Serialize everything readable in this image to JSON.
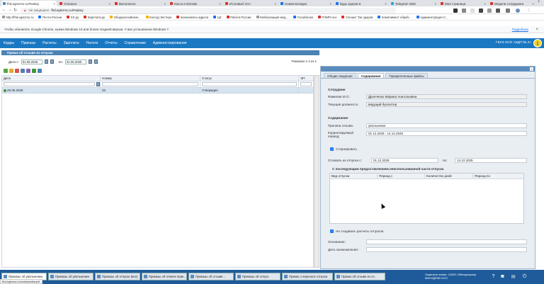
{
  "browser": {
    "tabs": [
      {
        "label": "fhd.egiszrso.ru/#salary",
        "color": "#4a83b4",
        "active": true
      },
      {
        "label": "Успешно",
        "color": "#d93025"
      },
      {
        "label": "Выполнено",
        "color": "#d93025"
      },
      {
        "label": "Касса в Москве",
        "color": "#d93025"
      },
      {
        "label": "Итоговый тест",
        "color": "#d93025"
      },
      {
        "label": "Новая вкладка",
        "color": "#1a73e8"
      },
      {
        "label": "Будь здоров в",
        "color": "#1a73e8"
      },
      {
        "label": "Telegram Web",
        "color": "#2aa3e0"
      },
      {
        "label": "Моя страница",
        "color": "#d93025"
      },
      {
        "label": "Модели сотрудника",
        "color": "#d93025"
      }
    ],
    "insecure_label": "Не защищено",
    "url": "fhd.egiszrso.ru/#salary",
    "bookmarks": [
      {
        "label": "http://fhd.egiszrso.ru",
        "color": "#999999"
      },
      {
        "label": "Почта России",
        "color": "#1a73e8"
      },
      {
        "label": "XX.ру",
        "color": "#d93025"
      },
      {
        "label": "Зарплата.ру",
        "color": "#d93025"
      },
      {
        "label": "Общероссийские...",
        "color": "#f4b400"
      },
      {
        "label": "Контур.Экстерн",
        "color": "#f4b400"
      },
      {
        "label": "военкоматы адреса",
        "color": "#d93025"
      },
      {
        "label": "ЦЗ",
        "color": "#1a73e8"
      },
      {
        "label": "Работа России",
        "color": "#d93025"
      },
      {
        "label": "Мобилизация мед...",
        "color": "#999999"
      },
      {
        "label": "Госзаблоки",
        "color": "#1a73e8"
      },
      {
        "label": "РЭМП-нсо",
        "color": "#d93025"
      },
      {
        "label": "Спешит Так здоров",
        "color": "#d93025"
      },
      {
        "label": "Комплимент обраб...",
        "color": "#1a73e8"
      },
      {
        "label": "Администрация С...",
        "color": "#1a73e8"
      }
    ],
    "infobar_text": "Чтобы обновлять Google Chrome, нужна Windows 10 или более поздней версии. У вас установлена Windows 7.",
    "infobar_link": "Подробнее"
  },
  "app": {
    "menu": [
      "Кадры",
      "Приказы",
      "Расчеты",
      "Зарплата",
      "Налоги",
      "Отчеты",
      "Справочники",
      "Администрирование"
    ],
    "org_name": "ГБУЗ НСО «КДП № 2»",
    "info_icon_glyph": "i",
    "list": {
      "title": "Приказ об отзыве из отпуска",
      "date_from_label": "Дата с:",
      "date_from": "01.05.2025",
      "date_to_label": "по:",
      "date_to": "31.05.2025",
      "pager": "Показано 1-1 из 1",
      "columns": [
        "Дата",
        "Номер",
        "Статус",
        "ЭП"
      ],
      "rows": [
        {
          "date": "29.05.2025",
          "number": "33",
          "status": "Утвержден",
          "sign": ""
        }
      ]
    },
    "detail": {
      "tabs": [
        "Общие сведения",
        "Содержание",
        "Прикрепленные файлы"
      ],
      "active_tab": "Содержание",
      "employee_section": "Сотрудник",
      "fio_label": "Фамилия И.О.:",
      "fio_value": "Дронченко Марина Анатольевна",
      "position_label": "Текущая должность:",
      "position_value": "ведущий бухгалтер",
      "content_section": "Содержание",
      "reason_label": "Причина отзыва:",
      "reason_value": "увольнение",
      "period_label": "Корректируемый период:",
      "period_value": "01.12.2025 - 14.12.2025",
      "storno_label": "Сторнировать",
      "recall_from_label": "Отозвать из отпуска с:",
      "recall_from_value": "01.12.2025",
      "recall_to_label": "по:",
      "recall_to_value": "14.12.2025",
      "subsequent_title": "С последующим предоставлением неиспользованной части отпуска",
      "subgrid_columns": [
        "Вид отпуска",
        "Период с",
        "Количество дней",
        "Период по"
      ],
      "no_calc_label": "Не создавать расчеты отпусков",
      "basis_label": "Основание:",
      "ack_label": "Дата ознакомления:"
    }
  },
  "taskbar": {
    "tasks": [
      {
        "label": "Приказы об увольнении",
        "active": true
      },
      {
        "label": "Приказы об увольнении"
      },
      {
        "label": "Приказы об отпуске (все)"
      },
      {
        "label": "Приказы об отмене прик..."
      },
      {
        "label": "Приказы об отзыве..."
      },
      {
        "label": "Приказы об отпуск"
      },
      {
        "label": "Приказ о переносе отпуска"
      },
      {
        "label": "Приказ об отзыве из от..."
      }
    ],
    "license_line1": "Лицензия номер: 11626; Обещакорому",
    "license_line2": "МИНЗДРАВ НСО",
    "status_url": "fhd.egiszrso.ru/salary/salary/#"
  }
}
